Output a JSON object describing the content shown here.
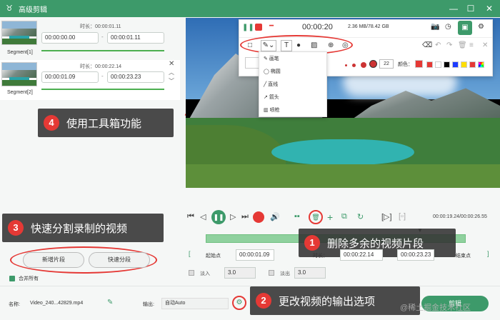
{
  "titlebar": {
    "title": "高级剪辑",
    "minimize": "—",
    "maximize": "☐",
    "close": "✕"
  },
  "segments": [
    {
      "label": "Segment[1]",
      "duration_label": "时长：00:00:01.11",
      "start": "00:00:00.00",
      "end": "00:00:01.11"
    },
    {
      "label": "Segment[2]",
      "duration_label": "时长：00:00:22.14",
      "start": "00:00:01.09",
      "end": "00:00:23.23"
    }
  ],
  "callouts": {
    "c1": {
      "num": "1",
      "text": "删除多余的视频片段"
    },
    "c2": {
      "num": "2",
      "text": "更改视频的输出选项"
    },
    "c3": {
      "num": "3",
      "text": "快速分割录制的视频"
    },
    "c4": {
      "num": "4",
      "text": "使用工具箱功能"
    }
  },
  "left_buttons": {
    "new_segment": "新增片段",
    "quick_split": "快速分段"
  },
  "merge_all": "合并所有",
  "toolbar": {
    "timer": "00:00:20",
    "size_info": "2.36 MB/78.42 GB",
    "font_size": "22",
    "color_label": "颜色："
  },
  "draw_menu": [
    "画笔",
    "椭圆",
    "直线",
    "箭头",
    "喷枪"
  ],
  "playback": {
    "time": "00:00:19.24/00:00:26.55"
  },
  "trim": {
    "start_btn": "起始点",
    "start_value": "00:00:01.09",
    "duration_label": "时长：",
    "duration_value": "00:00:22.14",
    "end_value": "00:00:23.23",
    "end_btn": "结束点"
  },
  "fade": {
    "fade_in": "淡入",
    "fade_in_value": "3.0",
    "fade_out": "淡出",
    "fade_out_value": "3.0"
  },
  "bottom": {
    "name_label": "名称:",
    "filename": "Video_240...42829.mp4",
    "output_label": "输出:",
    "output_value": "自动Auto",
    "cancel_btn": "取消",
    "export_btn": "剪辑",
    "watermark": "@稀土掘金技术社区"
  },
  "colors": {
    "accent": "#3d9a6a",
    "highlight": "#e53935",
    "callout_bg": "#323232"
  }
}
